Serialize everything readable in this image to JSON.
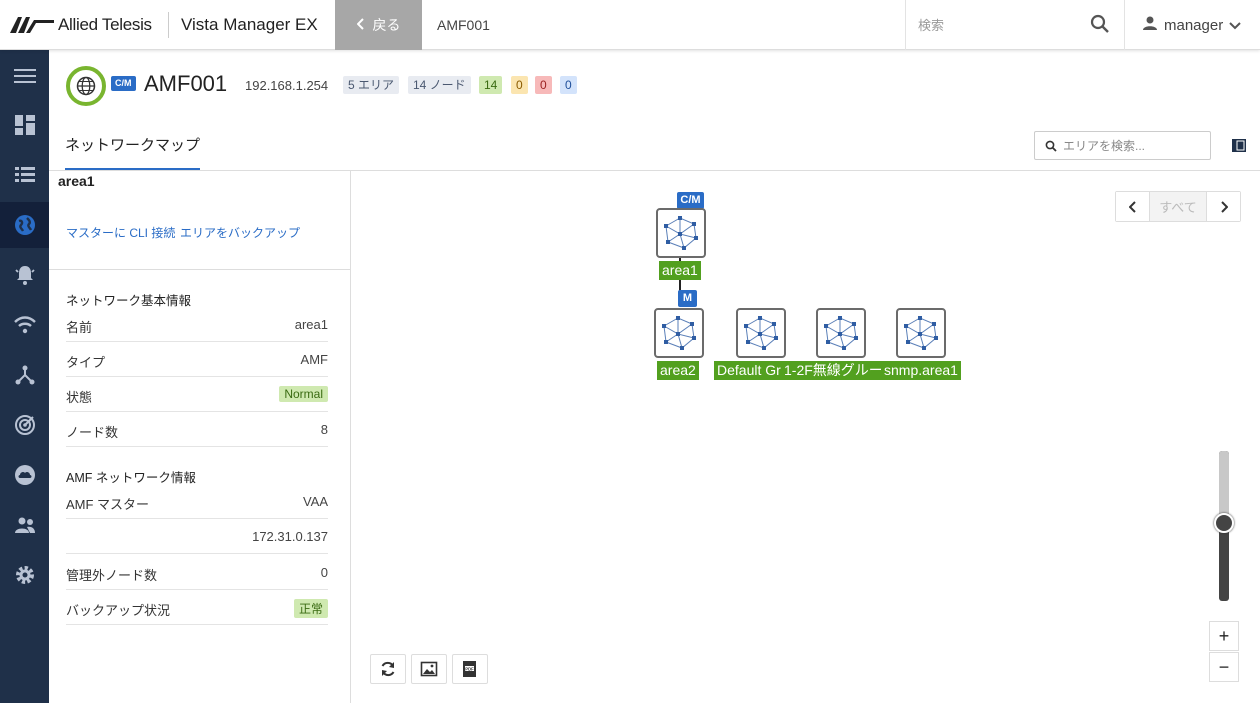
{
  "topbar": {
    "brand": "Allied Telesis",
    "product": "Vista Manager EX",
    "back_label": "戻る",
    "breadcrumb": "AMF001",
    "search_placeholder": "検索",
    "user_name": "manager"
  },
  "header": {
    "badge": "C/M",
    "title": "AMF001",
    "ip": "192.168.1.254",
    "areas": "5 エリア",
    "nodes": "14 ノード",
    "count_green": "14",
    "count_yellow": "0",
    "count_red": "0",
    "count_blue": "0",
    "tab": "ネットワークマップ",
    "area_search_placeholder": "エリアを検索..."
  },
  "panel": {
    "area_name": "area1",
    "link_cli": "マスターに CLI 接続",
    "link_backup": "エリアをバックアップ",
    "basic_title": "ネットワーク基本情報",
    "basic_rows": [
      {
        "k": "名前",
        "v": "area1"
      },
      {
        "k": "タイプ",
        "v": "AMF"
      },
      {
        "k": "状態",
        "v": "Normal"
      },
      {
        "k": "ノード数",
        "v": "8"
      }
    ],
    "amf_title": "AMF ネットワーク情報",
    "amf_rows": [
      {
        "k": "AMF マスター",
        "v": "VAA"
      },
      {
        "k": "",
        "v": "172.31.0.137"
      },
      {
        "k": "管理外ノード数",
        "v": "0"
      },
      {
        "k": "バックアップ状況",
        "v": "正常"
      }
    ]
  },
  "map": {
    "nav_all": "すべて",
    "nodes": [
      {
        "label": "area1",
        "badge": "C/M"
      },
      {
        "label": "area2",
        "badge": "M"
      },
      {
        "label": "Default Gr",
        "badge": ""
      },
      {
        "label": "1-2F無線グルー",
        "badge": ""
      },
      {
        "label": "snmp.area1",
        "badge": ""
      }
    ],
    "zoom_in": "+",
    "zoom_out": "−"
  },
  "colors": {
    "sidebar": "#1f3049",
    "accent": "#2a6cc6",
    "node_green": "#52a01f",
    "status_ring": "#79b52f"
  }
}
